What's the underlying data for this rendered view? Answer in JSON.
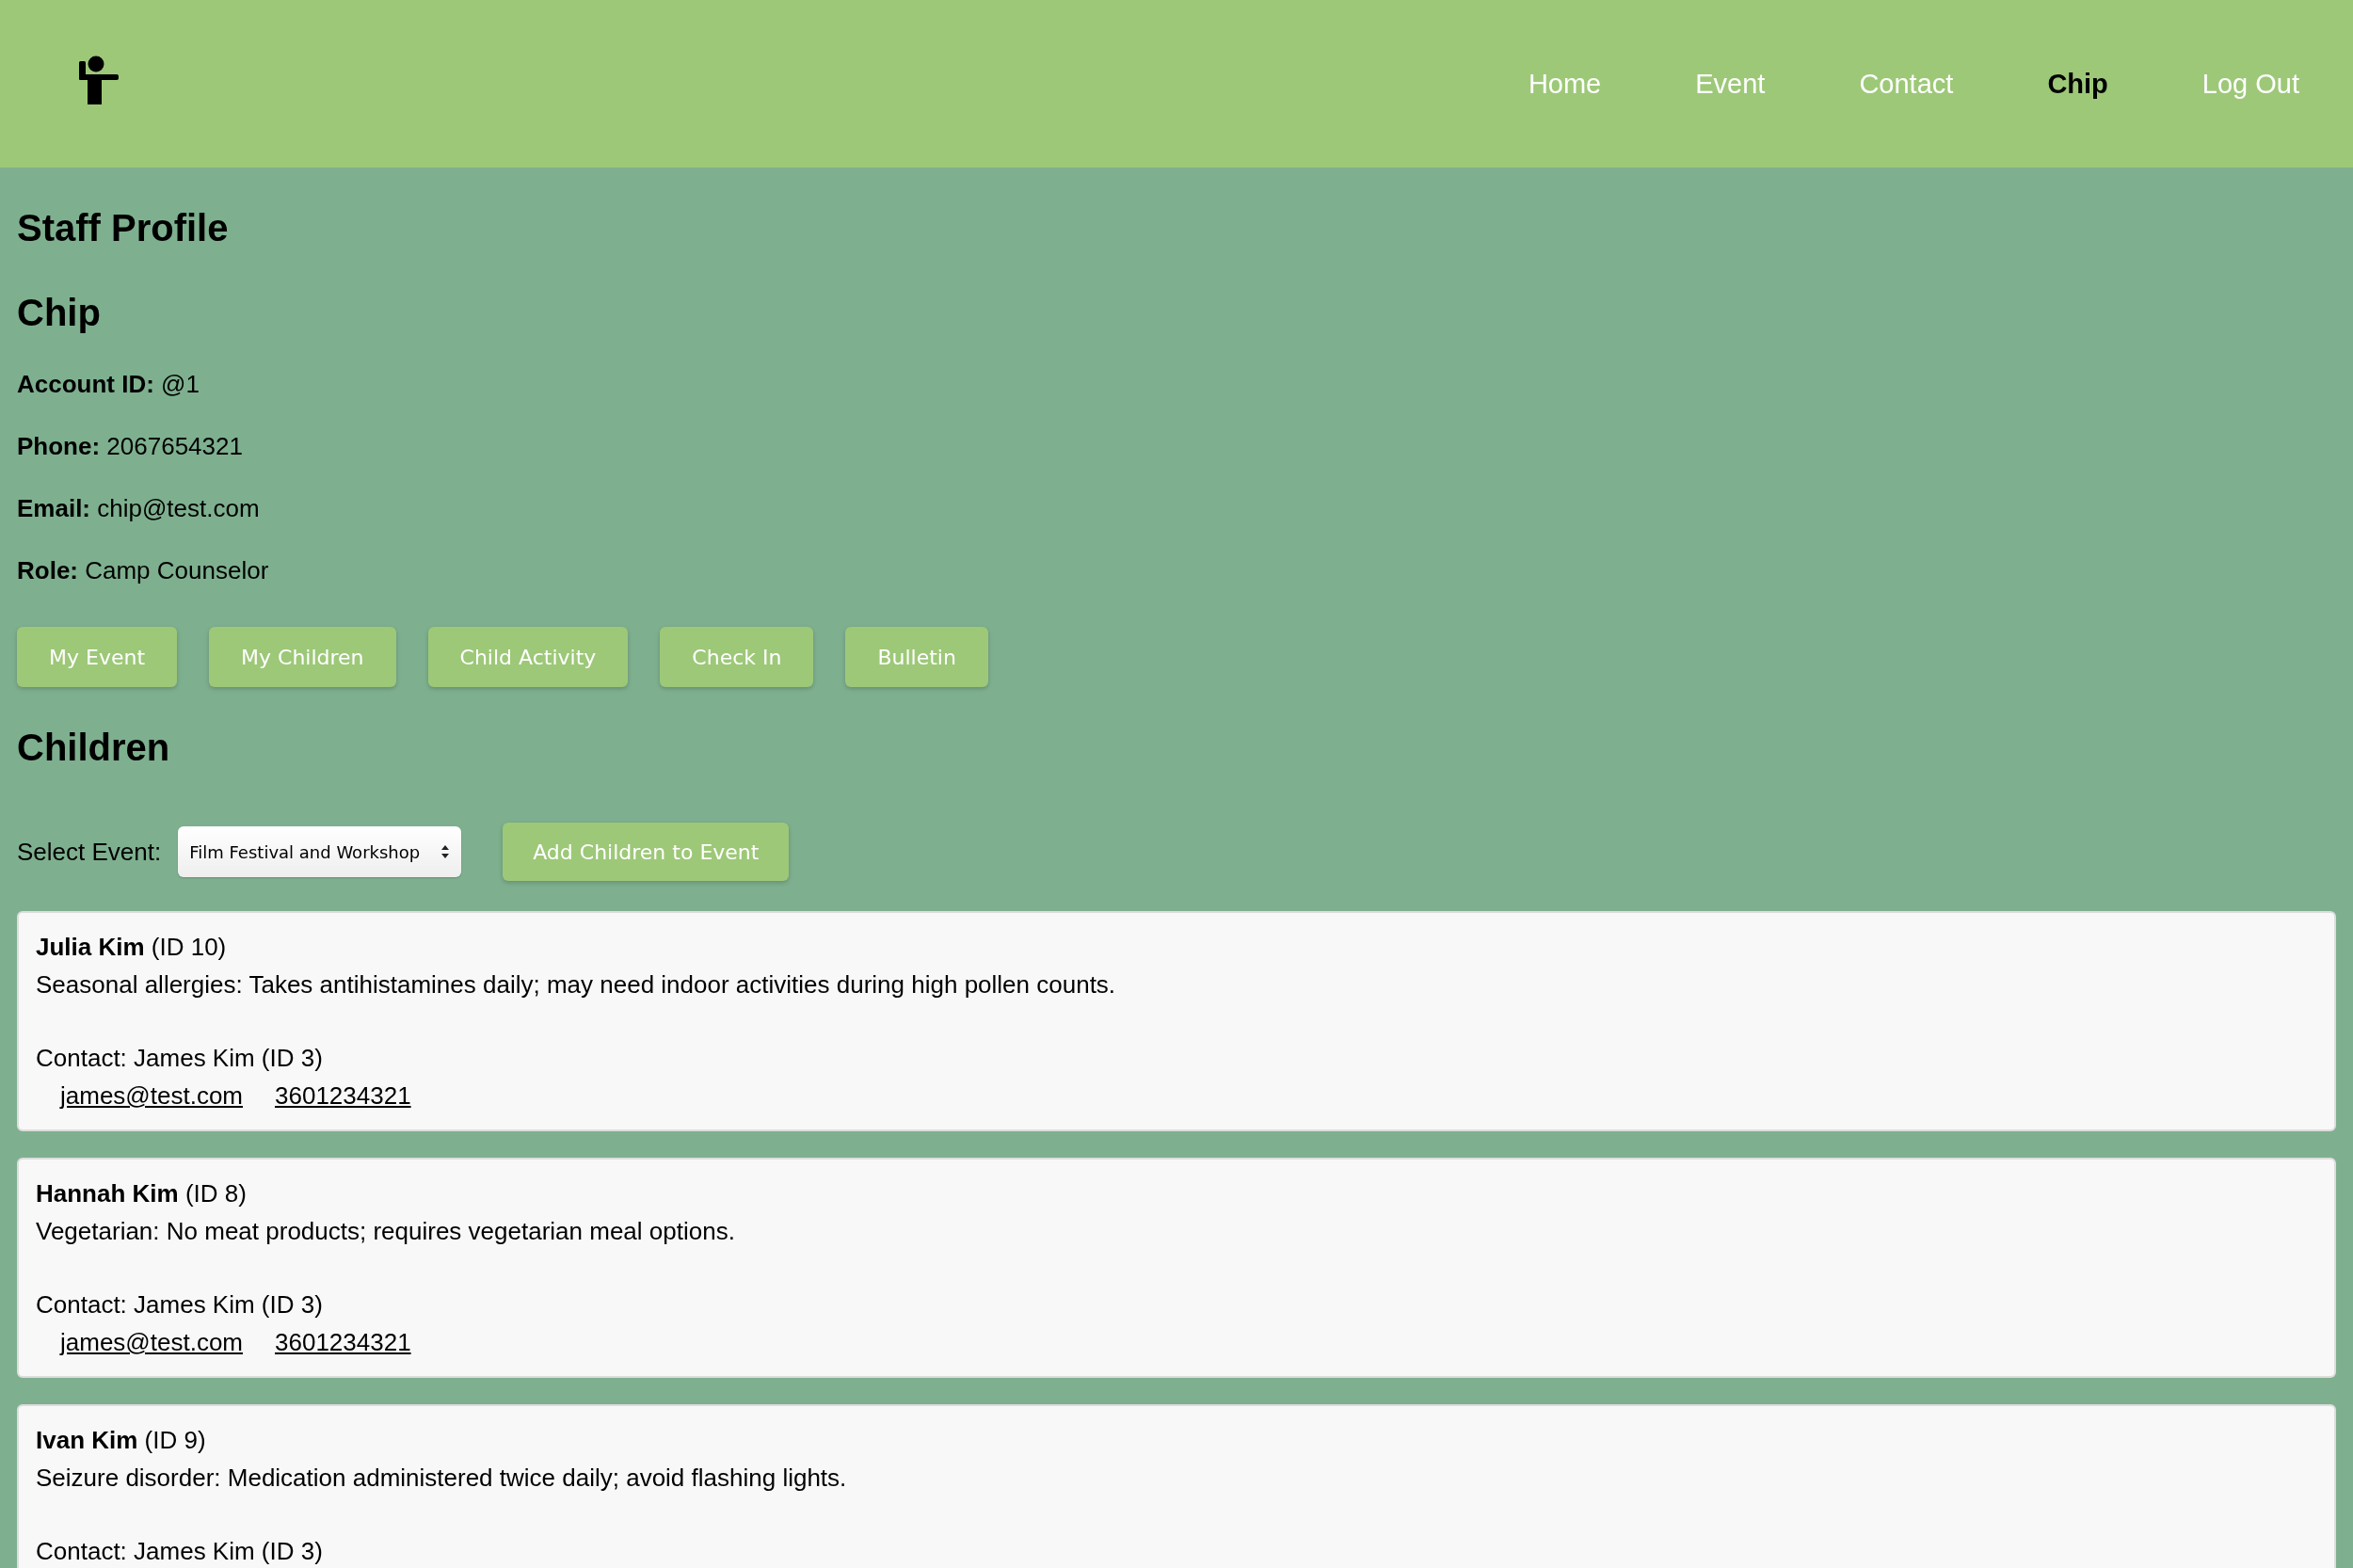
{
  "nav": {
    "items": [
      {
        "label": "Home",
        "selected": false
      },
      {
        "label": "Event",
        "selected": false
      },
      {
        "label": "Contact",
        "selected": false
      },
      {
        "label": "Chip",
        "selected": true
      },
      {
        "label": "Log Out",
        "selected": false
      }
    ]
  },
  "page_title": "Staff Profile",
  "profile": {
    "name": "Chip",
    "fields": [
      {
        "label": "Account ID:",
        "value": "@1"
      },
      {
        "label": "Phone:",
        "value": "2067654321"
      },
      {
        "label": "Email:",
        "value": "chip@test.com"
      },
      {
        "label": "Role:",
        "value": "Camp Counselor"
      }
    ]
  },
  "actions": [
    "My Event",
    "My Children",
    "Child Activity",
    "Check In",
    "Bulletin"
  ],
  "children_section": {
    "title": "Children",
    "select_label": "Select Event:",
    "select_value": "Film Festival and Workshop",
    "add_button": "Add Children to Event",
    "children": [
      {
        "name": "Julia Kim",
        "id": "(ID 10)",
        "note": "Seasonal allergies: Takes antihistamines daily; may need indoor activities during high pollen counts.",
        "contact": "Contact: James Kim (ID 3)",
        "links": [
          "james@test.com",
          "3601234321"
        ]
      },
      {
        "name": "Hannah Kim",
        "id": "(ID 8)",
        "note": "Vegetarian: No meat products; requires vegetarian meal options.",
        "contact": "Contact: James Kim (ID 3)",
        "links": [
          "james@test.com",
          "3601234321"
        ]
      },
      {
        "name": "Ivan Kim",
        "id": "(ID 9)",
        "note": "Seizure disorder: Medication administered twice daily; avoid flashing lights.",
        "contact": "Contact: James Kim (ID 3)"
      }
    ]
  }
}
